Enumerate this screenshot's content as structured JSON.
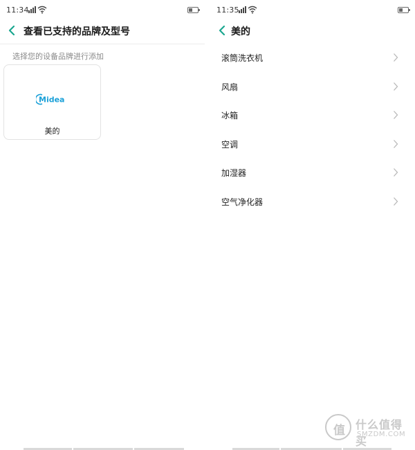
{
  "left_screen": {
    "status_bar": {
      "time": "11:34",
      "battery_level": 0.35
    },
    "header": {
      "title": "查看已支持的品牌及型号",
      "back_icon": "chevron-left-icon"
    },
    "hint": "选择您的设备品牌进行添加",
    "brands": [
      {
        "logo": "Midea",
        "label": "美的"
      }
    ]
  },
  "right_screen": {
    "status_bar": {
      "time": "11:35",
      "battery_level": 0.35
    },
    "header": {
      "title": "美的",
      "back_icon": "chevron-left-icon"
    },
    "items": [
      {
        "label": "滚筒洗衣机"
      },
      {
        "label": "风扇"
      },
      {
        "label": "冰箱"
      },
      {
        "label": "空调"
      },
      {
        "label": "加湿器"
      },
      {
        "label": "空气净化器"
      }
    ]
  },
  "watermark": {
    "glyph": "值",
    "text_cn": "什么值得买",
    "text_en": "SMZDM.COM"
  },
  "colors": {
    "accent": "#1aa78f",
    "brand_blue": "#1aa0d8",
    "divider": "#ececec",
    "hint": "#8a8a8a"
  }
}
